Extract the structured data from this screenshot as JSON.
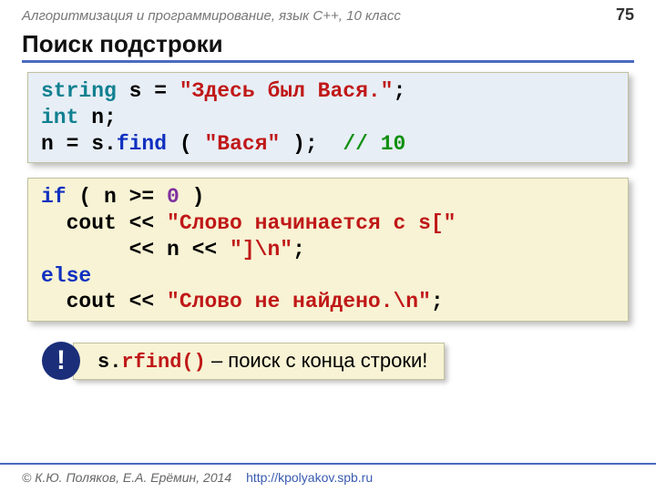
{
  "header": {
    "subject": "Алгоритмизация и программирование, язык C++, 10 класс",
    "page": "75"
  },
  "title": "Поиск подстроки",
  "code1": {
    "l1a": "string",
    "l1b": " s = ",
    "l1c": "\"Здесь был Вася.\"",
    "l1d": ";",
    "l2a": "int",
    "l2b": " n;",
    "l3a": "n = s.",
    "l3b": "find",
    "l3c": " ( ",
    "l3d": "\"Вася\"",
    "l3e": " );  ",
    "l3f": "// 10"
  },
  "code2": {
    "l1a": "if",
    "l1b": " ( n >= ",
    "l1c": "0",
    "l1d": " )",
    "l2a": "  cout << ",
    "l2b": "\"Слово начинается с s[\"",
    "l3a": "       << n << ",
    "l3b": "\"]\\n\"",
    "l3c": ";",
    "l4a": "else",
    "l5a": "  cout << ",
    "l5b": "\"Слово не найдено.\\n\"",
    "l5c": ";"
  },
  "note": {
    "badge": "!",
    "code_pre": "s.",
    "code_fn": "rfind()",
    "text": " – поиск с конца строки!"
  },
  "footer": {
    "authors": "© К.Ю. Поляков, Е.А. Ерёмин, 2014",
    "url": "http://kpolyakov.spb.ru"
  }
}
